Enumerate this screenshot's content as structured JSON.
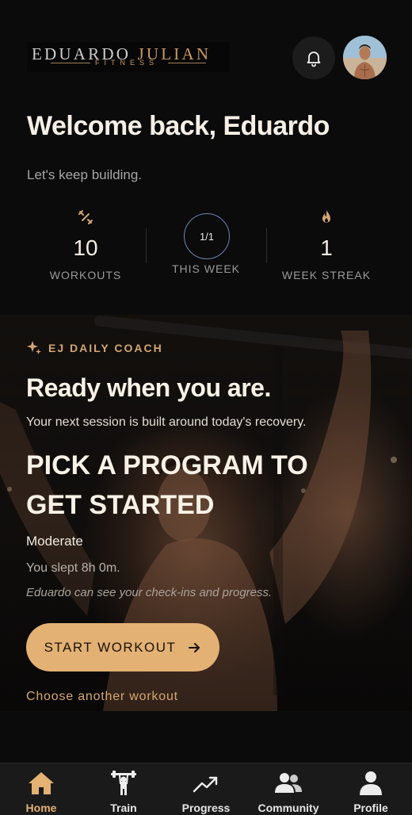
{
  "header": {
    "logo_main_1": "EDUARDO",
    "logo_main_2": "JULIAN",
    "logo_sub": "FITNESS",
    "notifications_icon": "bell-icon",
    "avatar": "profile-photo"
  },
  "welcome": {
    "title": "Welcome back, Eduardo",
    "subtitle": "Let's keep building."
  },
  "stats": [
    {
      "icon": "dumbbell-icon",
      "value": "10",
      "label": "WORKOUTS"
    },
    {
      "icon": "progress-ring",
      "value": "1/1",
      "label": "THIS WEEK"
    },
    {
      "icon": "flame-icon",
      "value": "1",
      "label": "WEEK STREAK"
    }
  ],
  "coach": {
    "tag": "EJ DAILY COACH",
    "title": "Ready when you are.",
    "subtitle": "Your next session is built around today's recovery.",
    "program": "PICK A PROGRAM TO GET STARTED",
    "intensity": "Moderate",
    "sleep": "You slept 8h 0m.",
    "note": "Eduardo can see your check-ins and progress.",
    "start_label": "START WORKOUT",
    "choose_label": "Choose another workout"
  },
  "nav": [
    {
      "label": "Home",
      "icon": "home-icon",
      "active": true
    },
    {
      "label": "Train",
      "icon": "weightlifter-icon",
      "active": false
    },
    {
      "label": "Progress",
      "icon": "trend-up-icon",
      "active": false
    },
    {
      "label": "Community",
      "icon": "people-icon",
      "active": false
    },
    {
      "label": "Profile",
      "icon": "person-icon",
      "active": false
    }
  ],
  "colors": {
    "accent": "#e3b174",
    "background": "#0b0b0b",
    "nav_background": "#1a1a1a",
    "ring": "#6b86b4"
  }
}
